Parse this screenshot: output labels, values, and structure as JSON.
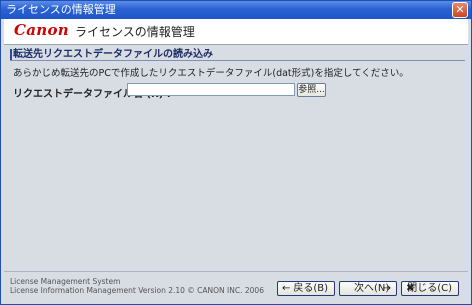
{
  "window": {
    "title": "ライセンスの情報管理",
    "close_glyph": "✕"
  },
  "header": {
    "logo": "Canon",
    "title": "ライセンスの情報管理"
  },
  "section": {
    "title": "転送先リクエストデータファイルの読み込み",
    "description": "あらかじめ転送先のPCで作成したリクエストデータファイル(dat形式)を指定してください。"
  },
  "form": {
    "file_label": "リクエストデータファイル名 (R) :",
    "file_value": "",
    "browse_label": "参照..."
  },
  "footer": {
    "line1": "License Management System",
    "line2": "License Information Management Version 2.10 © CANON INC. 2006"
  },
  "buttons": {
    "back": {
      "label": "戻る(B)",
      "icon": "←"
    },
    "next": {
      "label": "次へ(N)",
      "icon": "→"
    },
    "close": {
      "label": "閉じる(C)",
      "icon": "✖"
    }
  }
}
